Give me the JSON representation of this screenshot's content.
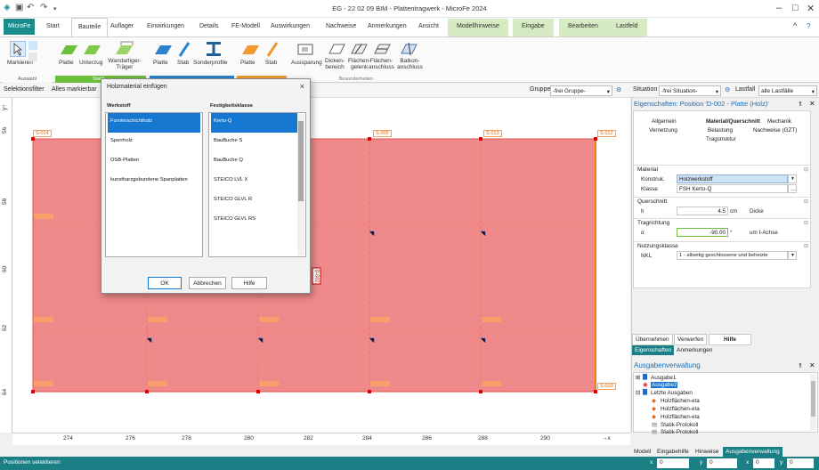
{
  "app": {
    "title": "EG - 22 02 09 BIM - Plattentragwerk - MicroFe 2024"
  },
  "tabs": [
    {
      "label": "MicroFe"
    },
    {
      "label": "Start"
    },
    {
      "label": "Bauteile"
    },
    {
      "label": "Auflager"
    },
    {
      "label": "Einwirkungen"
    },
    {
      "label": "Details"
    },
    {
      "label": "FE-Modell"
    },
    {
      "label": "Auswirkungen"
    },
    {
      "label": "Nachweise"
    },
    {
      "label": "Anmerkungen"
    },
    {
      "label": "Ansicht"
    },
    {
      "label": "Modellhinweise"
    },
    {
      "label": "Eingabe"
    },
    {
      "label": "Bearbeiten"
    },
    {
      "label": "Lastfeld"
    }
  ],
  "ribbon": {
    "markieren": "Markieren",
    "auswahl": "Auswahl",
    "platte": "Platte",
    "unterzug": "Unterzug",
    "wandartiger": "Wandartiger-",
    "traeger": "Träger",
    "platte2": "Platte",
    "stab": "Stab",
    "sonderprofile": "Sonderprofile",
    "platte3": "Platte",
    "stab3": "Stab",
    "aussparung": "Aussparung",
    "dicken": "Dicken-",
    "bereich": "bereich",
    "flaechen": "Flächen-",
    "gelenk": "gelenk",
    "flaechen2": "Flächen-",
    "anschluss": "anschluss",
    "balkon": "Balkon-",
    "anschluss2": "anschluss",
    "grp_statik": "Statik...",
    "grp_besonder": "Besonderheiten"
  },
  "toolbar": {
    "selektionsfilter": "Selektionsfilter",
    "filter_value": "Alles markierbar",
    "gruppe_label": "Gruppe",
    "gruppe_value": "-frei Gruppe-",
    "situation_label": "Situation",
    "situation_value": "-frei Situation-",
    "lastfall_label": "Lastfall",
    "lastfall_value": "alle Lastfälle"
  },
  "canvas": {
    "y_labels": [
      "56",
      "58",
      "60",
      "62",
      "64"
    ],
    "x_labels": [
      "274",
      "276",
      "278",
      "280",
      "282",
      "284",
      "286",
      "288",
      "290"
    ],
    "x_axis": "→x",
    "supports": [
      "S-014",
      "S-005",
      "S-013",
      "S-012",
      "S-010"
    ],
    "plate_label": "D-002"
  },
  "dialog": {
    "title": "Holzmaterial einfügen",
    "close": "×",
    "col1": "Werkstoff",
    "col2": "Festigkeitsklasse",
    "werkstoffe": [
      "Furnierschichtholz",
      "Sperrholz",
      "OSB-Platten",
      "kunstharzgebundene Spanplatten"
    ],
    "klassen": [
      "Kerto-Q",
      "BauBuche S",
      "BauBuche Q",
      "STEICO LVL X",
      "STEICO GLVL R",
      "STEICO GLVL RS"
    ],
    "ok": "OK",
    "cancel": "Abbrechen",
    "help": "Hilfe"
  },
  "props": {
    "title": "Eigenschaften: Position 'D-002 - Platte (Holz)'",
    "tabs": [
      "Allgemein",
      "Material/Querschnitt",
      "Mechanik",
      "Vernetzung",
      "Belastung",
      "Nachweise (GZT)",
      "Tragstruktur"
    ],
    "sec_material": "Material",
    "konstruk_label": "Konstruk.",
    "konstruk_value": "Holzwerkstoff",
    "klasse_label": "Klasse",
    "klasse_value": "FSH Kerto-Q",
    "sec_querschnitt": "Querschnitt",
    "h_label": "h",
    "h_value": "4.5",
    "h_unit": "cm",
    "h_desc": "Dicke",
    "sec_tragrichtung": "Tragrichtung",
    "alpha_label": "α",
    "alpha_value": "-90.00",
    "alpha_unit": "°",
    "alpha_desc": "um t-Achse",
    "sec_nkl": "Nutzungsklasse",
    "nkl_label": "NKL",
    "nkl_value": "1 - allseitig geschlossene und beheizte",
    "btn_apply": "Übernehmen",
    "btn_discard": "Verwerfen",
    "btn_help": "Hilfe",
    "ptab1": "Eigenschaften",
    "ptab2": "Anmerkungen"
  },
  "ausgabe": {
    "title": "Ausgabenverwaltung",
    "items": [
      "Ausgabe1",
      "Ausgabe2",
      "Letzte Ausgaben",
      "Holzflächen-eta",
      "Holzflächen-eta",
      "Holzflächen-eta",
      "Statik-Protokoll",
      "Statik-Protokoll"
    ],
    "tabs": [
      "Modell",
      "Eingabehilfe",
      "Hinweise",
      "Ausgabenverwaltung"
    ]
  },
  "status": {
    "text": "Positionen selektieren",
    "x_label": "x",
    "x_val": "0",
    "y_label": "y",
    "y_val": "0",
    "x2_label": "x",
    "x2_val": "0",
    "y2_label": "y",
    "y2_val": "0"
  },
  "colors": {
    "teal": "#1b7f86",
    "plate": "#f08a8a",
    "select": "#1778d2"
  }
}
